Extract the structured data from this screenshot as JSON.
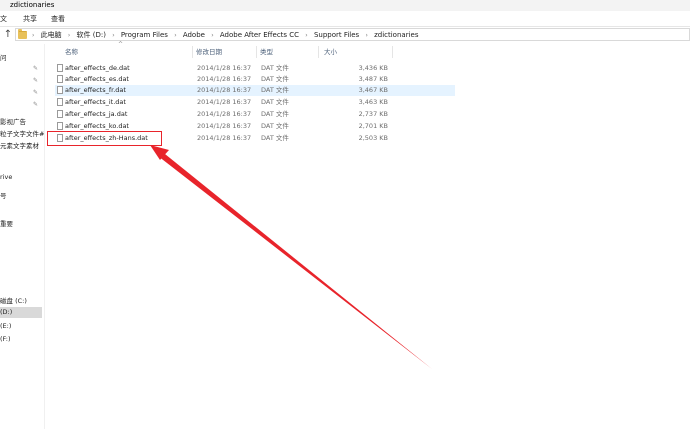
{
  "window": {
    "title": "zdictionaries"
  },
  "ribbon": {
    "tabs": [
      "文",
      "共享",
      "查看"
    ]
  },
  "address": {
    "crumbs": [
      "此电脑",
      "软件 (D:)",
      "Program Files",
      "Adobe",
      "Adobe After Effects CC",
      "Support Files",
      "zdictionaries"
    ]
  },
  "nav": {
    "items": [
      "问",
      "影视广告",
      "粒子文字文件#",
      "元素文字素材",
      "rive",
      "号",
      "重要",
      "磁盘 (C:)",
      "(D:)",
      "(E:)",
      "(F:)"
    ]
  },
  "columns": {
    "name": "名称",
    "date": "修改日期",
    "type": "类型",
    "size": "大小"
  },
  "files": [
    {
      "name": "after_effects_de.dat",
      "date": "2014/1/28 16:37",
      "type": "DAT 文件",
      "size": "3,436 KB"
    },
    {
      "name": "after_effects_es.dat",
      "date": "2014/1/28 16:37",
      "type": "DAT 文件",
      "size": "3,487 KB"
    },
    {
      "name": "after_effects_fr.dat",
      "date": "2014/1/28 16:37",
      "type": "DAT 文件",
      "size": "3,467 KB"
    },
    {
      "name": "after_effects_it.dat",
      "date": "2014/1/28 16:37",
      "type": "DAT 文件",
      "size": "3,463 KB"
    },
    {
      "name": "after_effects_ja.dat",
      "date": "2014/1/28 16:37",
      "type": "DAT 文件",
      "size": "2,737 KB"
    },
    {
      "name": "after_effects_ko.dat",
      "date": "2014/1/28 16:37",
      "type": "DAT 文件",
      "size": "2,701 KB"
    },
    {
      "name": "after_effects_zh-Hans.dat",
      "date": "2014/1/28 16:37",
      "type": "DAT 文件",
      "size": "2,503 KB"
    }
  ],
  "annotation_color": "#e8242b"
}
